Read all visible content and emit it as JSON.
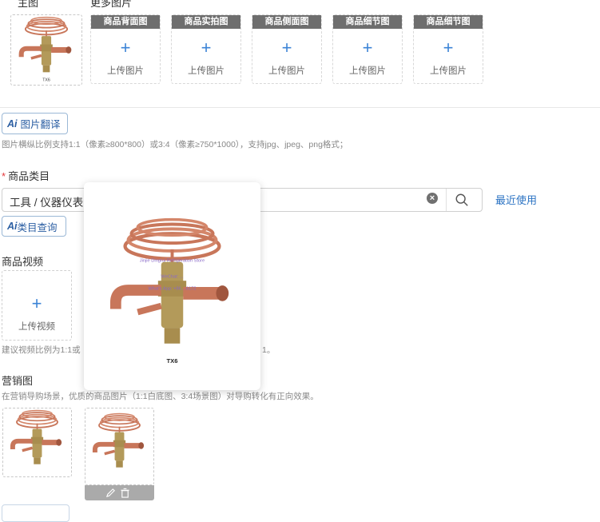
{
  "top_labels": {
    "main_image": "主图",
    "more_images": "更多图片"
  },
  "image_slots": [
    {
      "title": "商品背面图",
      "upload": "上传图片"
    },
    {
      "title": "商品实拍图",
      "upload": "上传图片"
    },
    {
      "title": "商品侧面图",
      "upload": "上传图片"
    },
    {
      "title": "商品细节图",
      "upload": "上传图片"
    },
    {
      "title": "商品细节图",
      "upload": "上传图片"
    }
  ],
  "image_translate": {
    "ai_tag": "Ai",
    "label": "图片翻译"
  },
  "image_hint": "图片横纵比例支持1:1（像素≥800*800）或3:4（像素≥750*1000），支持jpg、jpeg、png格式；",
  "category": {
    "required_mark": "*",
    "title": "商品类目",
    "value": "工具 / 仪器仪表",
    "recent": "最近使用",
    "ai_query": {
      "ai_tag": "Ai",
      "label": "类目查询"
    }
  },
  "video": {
    "title": "商品视频",
    "upload": "上传视频",
    "hint_left": "建议视频比例为1:1或",
    "hint_right": "1。"
  },
  "marketing": {
    "title": "营销图",
    "hint": "在营销导购场景，优质的商品图片（1:1白底图、3:4场景图）对导购转化有正向效果。"
  },
  "product_image": {
    "model_label": "TX6",
    "watermark_lines": [
      "Jinjie Dingrui Refrigeration Store",
      "WeChat: ...",
      "What's App: +86 ...6172"
    ]
  },
  "colors": {
    "accent": "#2b73c3",
    "slot_header": "#6e6e6e",
    "required": "#e4393c",
    "copper": "#c8765a",
    "brass": "#b39a5a"
  }
}
